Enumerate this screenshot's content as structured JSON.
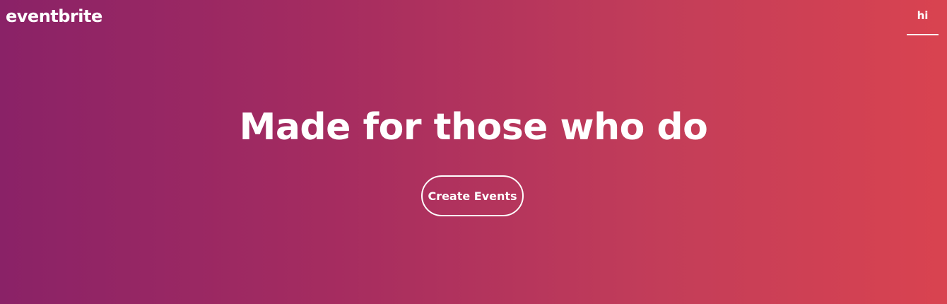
{
  "header": {
    "logo_text": "eventbrite",
    "user_menu_label": "hi"
  },
  "hero": {
    "headline": "Made for those who do",
    "cta_label": "Create Events"
  },
  "colors": {
    "gradient_start": "#8a2267",
    "gradient_end": "#d94350",
    "text": "#ffffff"
  }
}
